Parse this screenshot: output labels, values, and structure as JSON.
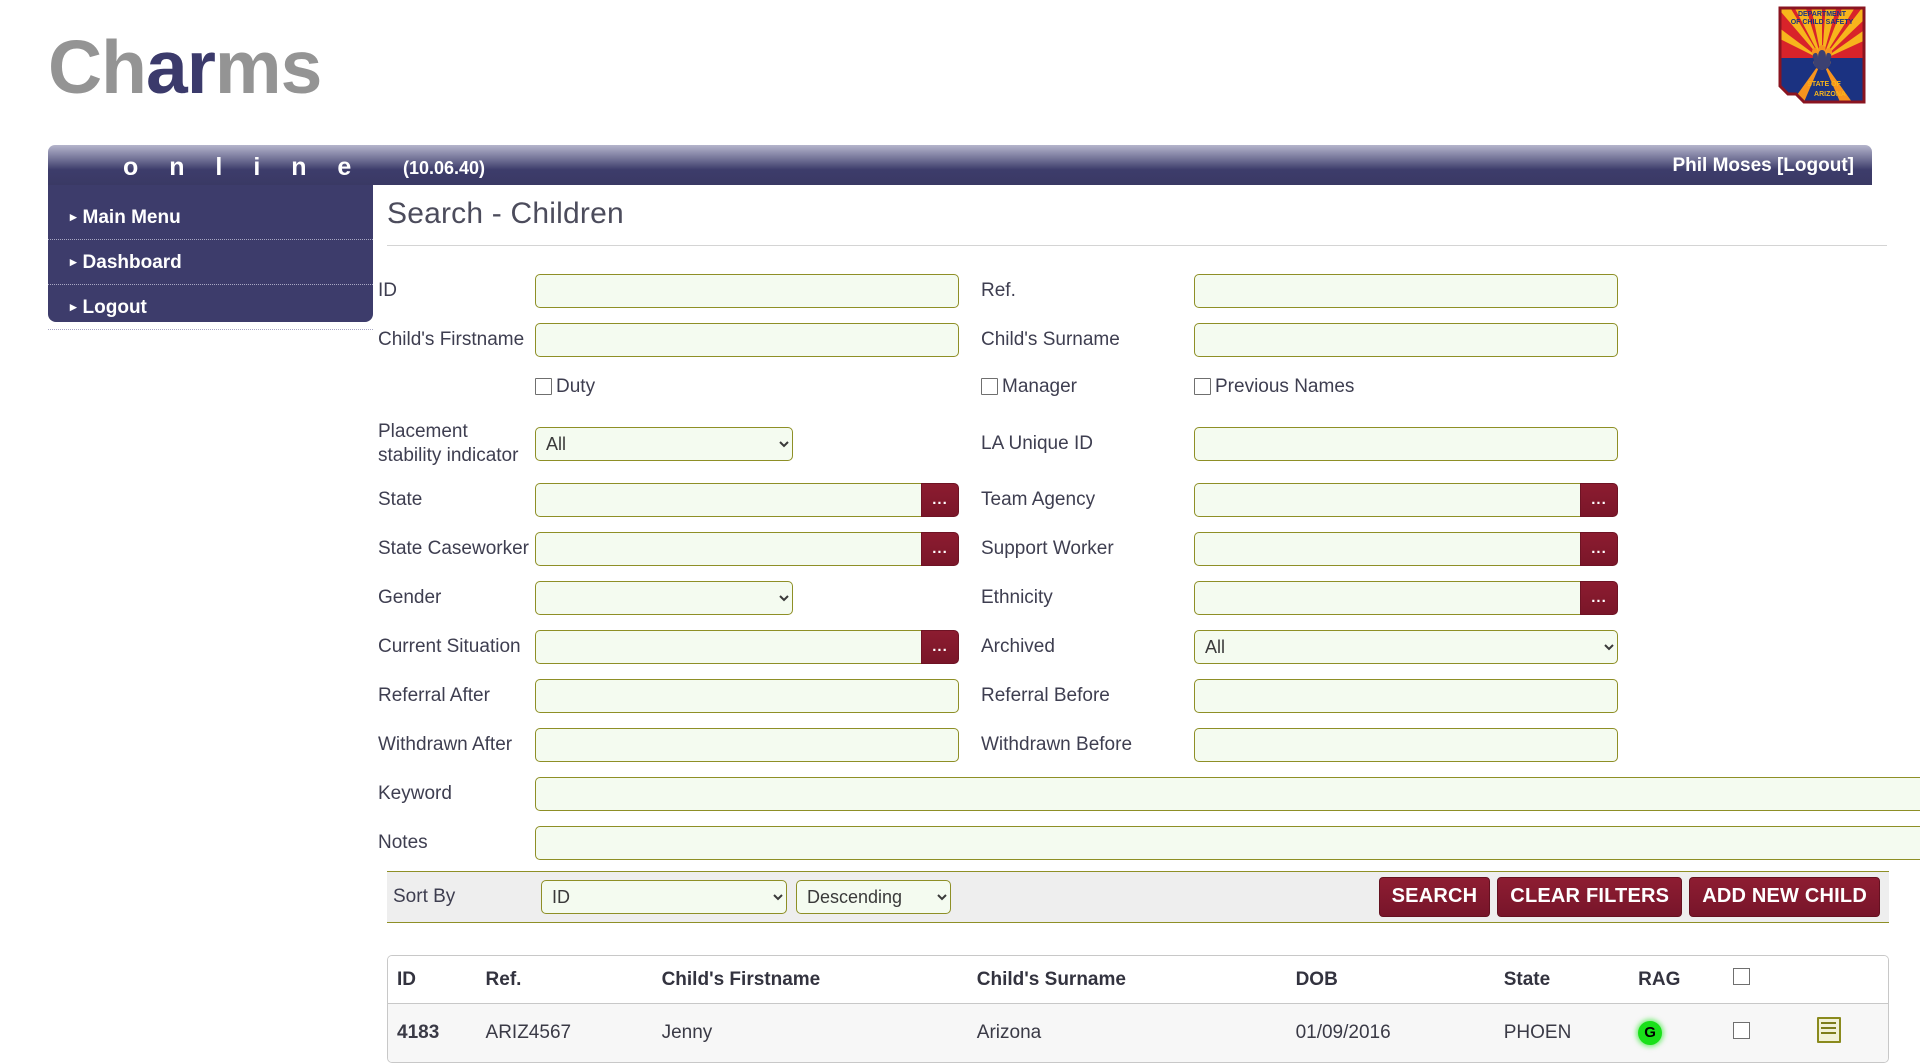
{
  "brand": {
    "name_part1": "Ch",
    "name_accent": "ar",
    "name_part2": "ms",
    "subtitle": "o n l i n e",
    "version": "(10.06.40)"
  },
  "header": {
    "user_name": "Phil Moses",
    "logout_label": "[Logout]",
    "seal_alt": "seal-department-of-child-safety-state-of-arizona",
    "seal_line1": "DEPARTMENT",
    "seal_line2": "OF CHILD SAFETY",
    "seal_line3": "STATE OF",
    "seal_line4": "ARIZONA"
  },
  "sidebar": {
    "items": [
      {
        "label": "Main Menu"
      },
      {
        "label": "Dashboard"
      },
      {
        "label": "Logout"
      }
    ]
  },
  "main": {
    "page_title": "Search - Children"
  },
  "form": {
    "labels": {
      "id": "ID",
      "ref": "Ref.",
      "child_firstname": "Child's Firstname",
      "child_surname": "Child's Surname",
      "duty": "Duty",
      "manager": "Manager",
      "previous_names": "Previous Names",
      "placement_stability": "Placement stability indicator",
      "la_unique_id": "LA Unique ID",
      "state": "State",
      "team_agency": "Team Agency",
      "state_caseworker": "State Caseworker",
      "support_worker": "Support Worker",
      "gender": "Gender",
      "ethnicity": "Ethnicity",
      "current_situation": "Current Situation",
      "archived": "Archived",
      "referral_after": "Referral After",
      "referral_before": "Referral Before",
      "withdrawn_after": "Withdrawn After",
      "withdrawn_before": "Withdrawn Before",
      "keyword": "Keyword",
      "notes": "Notes",
      "sort_by": "Sort By"
    },
    "values": {
      "id": "",
      "ref": "",
      "child_firstname": "",
      "child_surname": "",
      "placement_stability": "All",
      "la_unique_id": "",
      "state": "",
      "team_agency": "",
      "state_caseworker": "",
      "support_worker": "",
      "gender": "",
      "ethnicity": "",
      "current_situation": "",
      "archived": "All",
      "referral_after": "",
      "referral_before": "",
      "withdrawn_after": "",
      "withdrawn_before": "",
      "keyword": "",
      "notes": "",
      "sort_by": "ID",
      "sort_direction": "Descending"
    },
    "lookup_button_label": "...",
    "checkboxes": {
      "duty_checked": false,
      "manager_checked": false,
      "previous_names_checked": false
    },
    "options": {
      "placement_stability": [
        "All"
      ],
      "gender": [
        ""
      ],
      "archived": [
        "All"
      ],
      "sort_by": [
        "ID"
      ],
      "sort_direction": [
        "Descending"
      ]
    }
  },
  "buttons": {
    "search": "SEARCH",
    "clear_filters": "CLEAR FILTERS",
    "add_new_child": "ADD NEW CHILD"
  },
  "results": {
    "columns": [
      "ID",
      "Ref.",
      "Child's Firstname",
      "Child's Surname",
      "DOB",
      "State",
      "RAG"
    ],
    "rows": [
      {
        "id": "4183",
        "ref": "ARIZ4567",
        "firstname": "Jenny",
        "surname": "Arizona",
        "dob": "01/09/2016",
        "state": "PHOEN",
        "rag": "G",
        "rag_color": "#19e019"
      }
    ]
  },
  "colors": {
    "brand_purple": "#3d3c6b",
    "brand_gray": "#949494",
    "field_border": "#8e8f26",
    "field_bg": "#f4fbf0",
    "action_maroon": "#8e1d32",
    "rag_green": "#19e019"
  }
}
